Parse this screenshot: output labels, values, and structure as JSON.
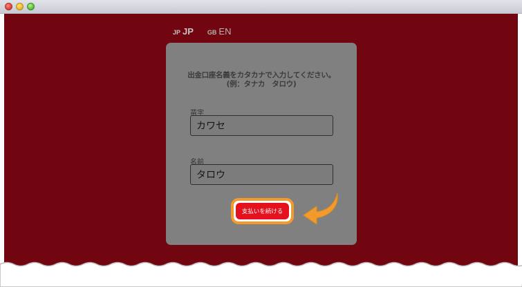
{
  "window": {
    "controls": [
      "close",
      "minimize",
      "zoom"
    ]
  },
  "languages": [
    {
      "code": "JP",
      "label": "JP",
      "active": true
    },
    {
      "code": "GB",
      "label": "EN",
      "active": false
    }
  ],
  "form": {
    "instruction_line1": "出金口座名義をカタカナで入力してください。",
    "instruction_line2": "(例：タナカ　タロウ)",
    "surname": {
      "label": "苗字",
      "value": "カワセ"
    },
    "given_name": {
      "label": "名前",
      "value": "タロウ"
    },
    "continue_label": "支払いを続ける"
  },
  "colors": {
    "background": "#710610",
    "card": "#808080",
    "button": "#e3121e",
    "highlight": "#f39a2d"
  },
  "icons": {
    "pointer": "curved-arrow-icon"
  }
}
